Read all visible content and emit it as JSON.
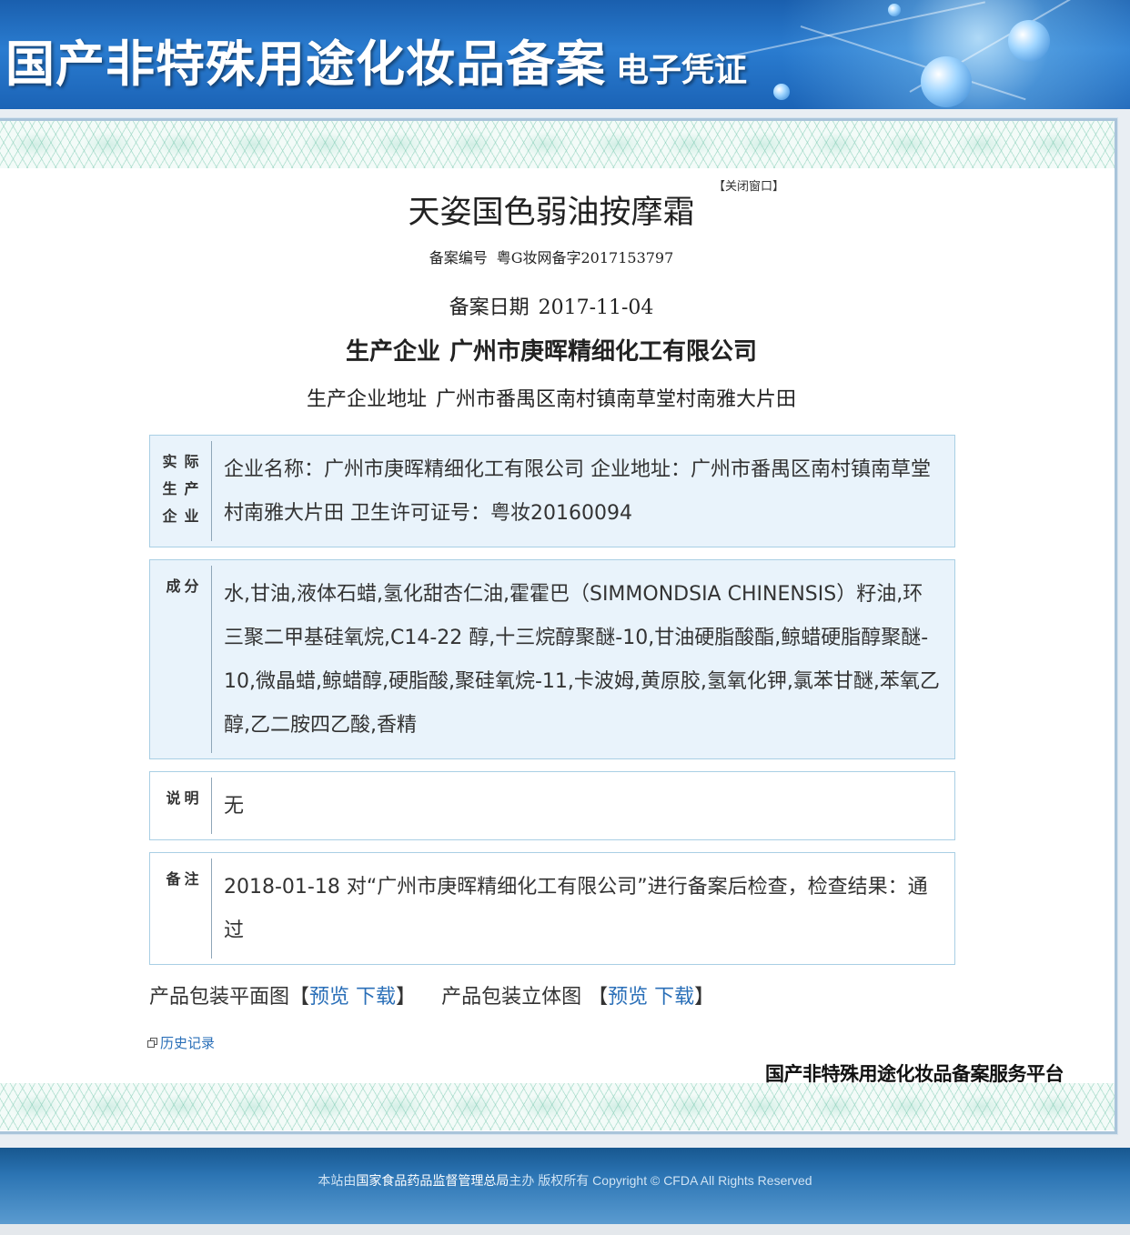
{
  "header": {
    "title": "国产非特殊用途化妆品备案",
    "subtitle": "电子凭证"
  },
  "record": {
    "close_label": "【关闭窗口】",
    "product_name": "天姿国色弱油按摩霜",
    "reg_no_label": "备案编号",
    "reg_no": "粤G妆网备字2017153797",
    "date_label": "备案日期",
    "date": "2017-11-04",
    "maker_label": "生产企业",
    "maker": "广州市庚晖精细化工有限公司",
    "maker_addr_label": "生产企业地址",
    "maker_addr": "广州市番禺区南村镇南草堂村南雅大片田"
  },
  "sections": {
    "actual_producer": {
      "label": "实际生产企业",
      "value": "企业名称：广州市庚晖精细化工有限公司 企业地址：广州市番禺区南村镇南草堂村南雅大片田 卫生许可证号：粤妆20160094"
    },
    "ingredients": {
      "label": "成分",
      "value": "水,甘油,液体石蜡,氢化甜杏仁油,霍霍巴（SIMMONDSIA CHINENSIS）籽油,环三聚二甲基硅氧烷,C14-22 醇,十三烷醇聚醚-10,甘油硬脂酸酯,鲸蜡硬脂醇聚醚-10,微晶蜡,鲸蜡醇,硬脂酸,聚硅氧烷-11,卡波姆,黄原胶,氢氧化钾,氯苯甘醚,苯氧乙醇,乙二胺四乙酸,香精"
    },
    "notes": {
      "label": "说明",
      "value": "无"
    },
    "remarks": {
      "label": "备注",
      "value": "2018-01-18 对“广州市庚晖精细化工有限公司”进行备案后检查，检查结果：通过"
    }
  },
  "packaging": {
    "flat_label": "产品包装平面图",
    "solid_label": "产品包装立体图",
    "open_bracket": "【",
    "close_bracket": "】",
    "preview": "预览",
    "download": "下载"
  },
  "history_label": "历史记录",
  "platform_logo": "国产非特殊用途化妆品备案服务平台",
  "footer": {
    "prefix": "本站由",
    "org": "国家食品药品监督管理总局",
    "suffix": "主办 版权所有 Copyright © CFDA All Rights Reserved"
  },
  "colors": {
    "banner": "#2a7cd0",
    "box_bg": "#e9f3fb",
    "box_border": "#a9cfe4",
    "link": "#2a6fb8",
    "footer": "#2b74b3"
  }
}
